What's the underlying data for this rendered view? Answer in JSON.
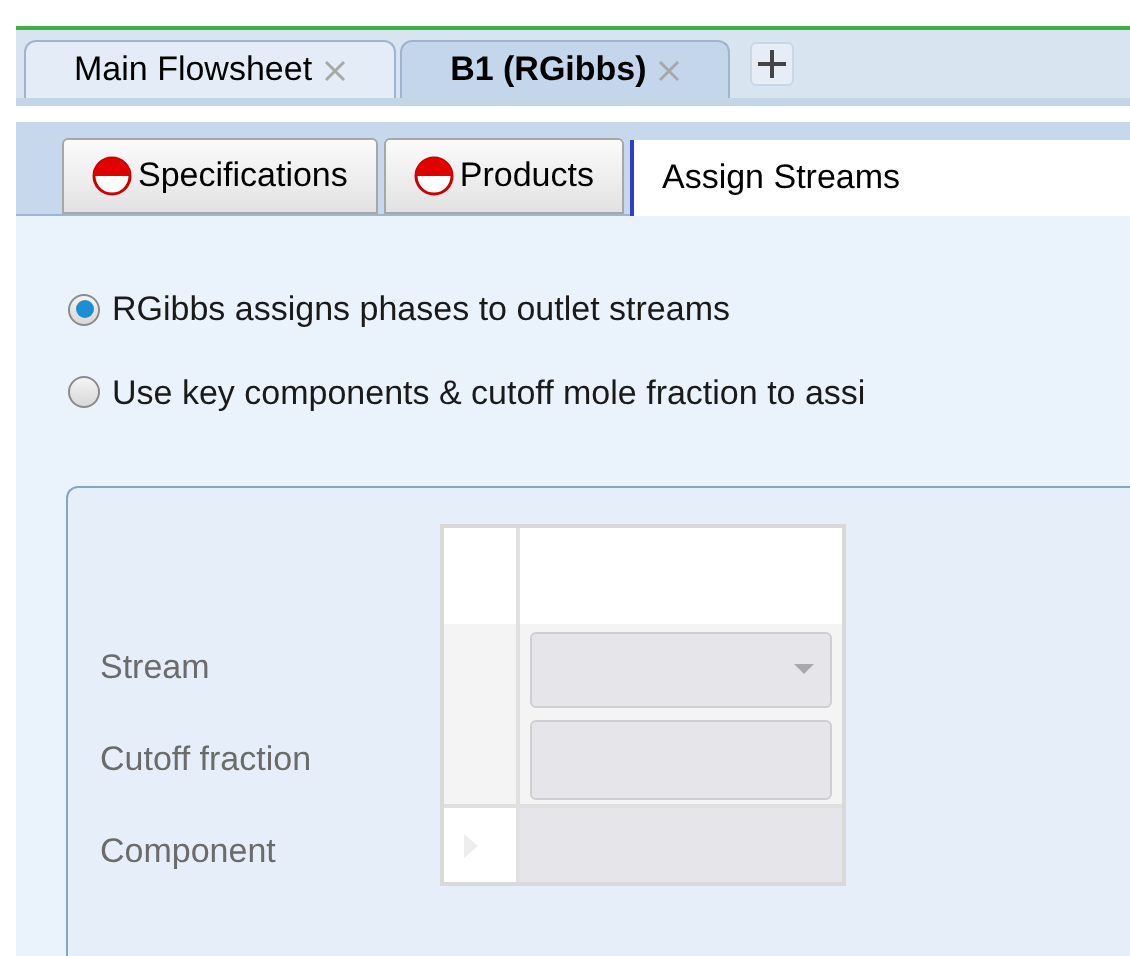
{
  "document_tabs": [
    {
      "label": "Main Flowsheet",
      "selected": false
    },
    {
      "label": "B1 (RGibbs)",
      "selected": true
    }
  ],
  "form_tabs": [
    {
      "label": "Specifications",
      "incomplete": true,
      "selected": false
    },
    {
      "label": "Products",
      "incomplete": true,
      "selected": false
    },
    {
      "label": "Assign Streams",
      "incomplete": false,
      "selected": true
    }
  ],
  "options": [
    {
      "label": "RGibbs assigns phases to outlet streams",
      "selected": true
    },
    {
      "label": "Use key components & cutoff mole fraction to assi",
      "selected": false
    }
  ],
  "fields": [
    {
      "label": "Stream",
      "kind": "dropdown"
    },
    {
      "label": "Cutoff fraction",
      "kind": "input"
    },
    {
      "label": "Component",
      "kind": "cell"
    }
  ]
}
